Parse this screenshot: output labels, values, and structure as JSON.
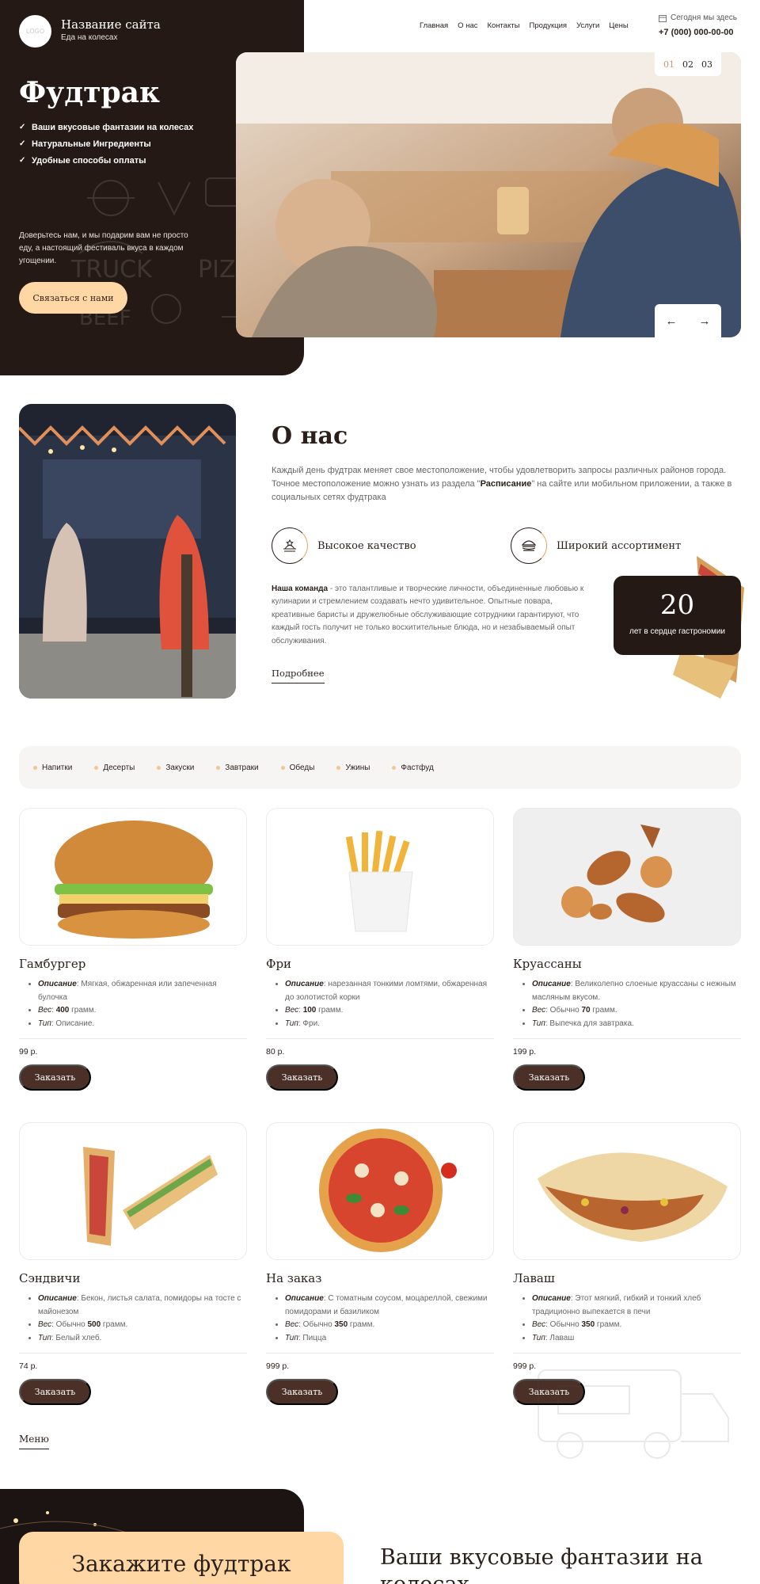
{
  "header": {
    "logo_text": "LOGO",
    "site_name": "Название сайта",
    "site_subtitle": "Еда на колесах",
    "nav": [
      "Главная",
      "О нас",
      "Контакты",
      "Продукция",
      "Услуги",
      "Цены"
    ],
    "schedule_label": "Сегодня мы здесь",
    "phone": "+7 (000) 000-00-00"
  },
  "hero": {
    "title": "Фудтрак",
    "bullets": [
      "Ваши вкусовые фантазии на колесах",
      "Натуральные Ингредиенты",
      "Удобные способы оплаты"
    ],
    "text": "Доверьтесь нам, и мы подарим вам не просто еду, а настоящий фестиваль вкуса в каждом угощении.",
    "button": "Связаться с нами",
    "slides": [
      "01",
      "02",
      "03"
    ],
    "active_slide": "01",
    "prev_arrow": "←",
    "next_arrow": "→"
  },
  "about": {
    "title": "О нас",
    "text_before": "Каждый день фудтрак меняет свое местоположение, чтобы удовлетворить запросы различных районов города. Точное местоположение можно узнать из раздела \"",
    "text_bold": "Расписание",
    "text_after": "\" на сайте или мобильном приложении, а также в социальных сетях фудтрака",
    "feature_1": "Высокое качество",
    "feature_2": "Широкий ассортимент",
    "team_bold": "Наша команда",
    "team_text": " - это талантливые и творческие личности, объединенные любовью к кулинарии и стремлением создавать нечто удивительное. Опытные повара, креативные баристы и дружелюбные обслуживающие сотрудники гарантируют, что каждый гость получит не только восхитительные блюда, но и незабываемый опыт обслуживания.",
    "more_link": "Подробнее",
    "years_number": "20",
    "years_label": "лет в сердце гастрономии"
  },
  "menu": {
    "categories": [
      "Напитки",
      "Десерты",
      "Закуски",
      "Завтраки",
      "Обеды",
      "Ужины",
      "Фастфуд"
    ],
    "desc_label": "Описание",
    "weight_label": "Вес",
    "type_label": "Тип",
    "order_button": "Заказать",
    "items": [
      {
        "title": "Гамбургер",
        "desc": ": Мягкая, обжаренная или запеченная булочка",
        "weight_pre": ": ",
        "weight_num": "400",
        "weight_post": " грамм.",
        "type": ": Описание.",
        "price": "99 р."
      },
      {
        "title": "Фри",
        "desc": ": нарезанная тонкими ломтями, обжаренная до золотистой корки",
        "weight_pre": ": ",
        "weight_num": "100",
        "weight_post": " грамм.",
        "type": ": Фри.",
        "price": "80 р."
      },
      {
        "title": "Круассаны",
        "desc": ": Великолепно слоеные круассаны с нежным масляным вкусом.",
        "weight_pre": ": Обычно ",
        "weight_num": "70",
        "weight_post": " грамм.",
        "type": ": Выпечка для завтрака.",
        "price": "199 р."
      },
      {
        "title": "Сэндвичи",
        "desc": ": Бекон, листья салата, помидоры на тосте с майонезом",
        "weight_pre": ": Обычно ",
        "weight_num": "500",
        "weight_post": " грамм.",
        "type": ": Белый хлеб.",
        "price": "74 р."
      },
      {
        "title": "На заказ",
        "desc": ": С томатным соусом, моцареллой, свежими помидорами и базиликом",
        "weight_pre": ": Обычно ",
        "weight_num": "350",
        "weight_post": " грамм.",
        "type": ": Пицца",
        "price": "999 р."
      },
      {
        "title": "Лаваш",
        "desc": ": Этот мягкий, гибкий и тонкий хлеб традиционно выпекается в печи",
        "weight_pre": ": Обычно ",
        "weight_num": "350",
        "weight_post": " грамм.",
        "type": ": Лаваш",
        "price": "999 р."
      }
    ],
    "menu_link": "Меню"
  },
  "bottom": {
    "order_title": "Закажите фудтрак",
    "heading": "Ваши вкусовые фантазии на колесах"
  },
  "colors": {
    "dark": "#241915",
    "accent": "#ffd7a4",
    "button": "#4a3027"
  }
}
